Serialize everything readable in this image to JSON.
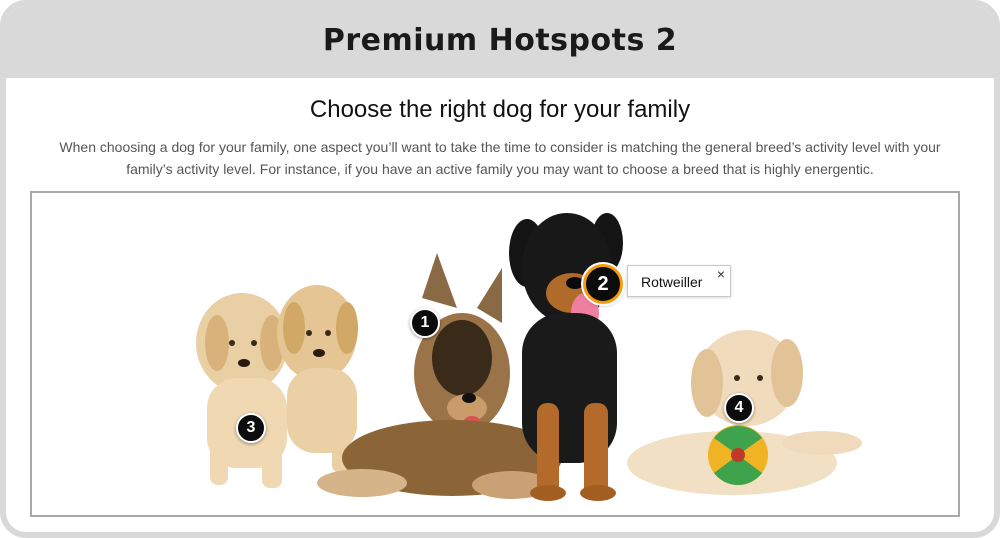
{
  "header": {
    "title": "Premium Hotspots 2"
  },
  "content": {
    "title": "Choose the right dog for your family",
    "description": "When choosing a dog for your family, one aspect you’ll want to take the time to consider is matching the general breed’s activity level with your family’s activity level. For instance, if you have an active family you may want to choose a breed that is highly energentic."
  },
  "hotspots": [
    {
      "number": "1",
      "subject": "german shepherd puppy"
    },
    {
      "number": "2",
      "subject": "rottweiler",
      "active": true
    },
    {
      "number": "3",
      "subject": "labrador puppies"
    },
    {
      "number": "4",
      "subject": "golden retriever puppy with ball"
    }
  ],
  "tooltip": {
    "label": "Rotweiller",
    "close_icon": "close-icon"
  },
  "colors": {
    "header_bg": "#d9d9d9",
    "active_ring": "#f39c12",
    "hotspot_bg": "#0c0c0c"
  }
}
